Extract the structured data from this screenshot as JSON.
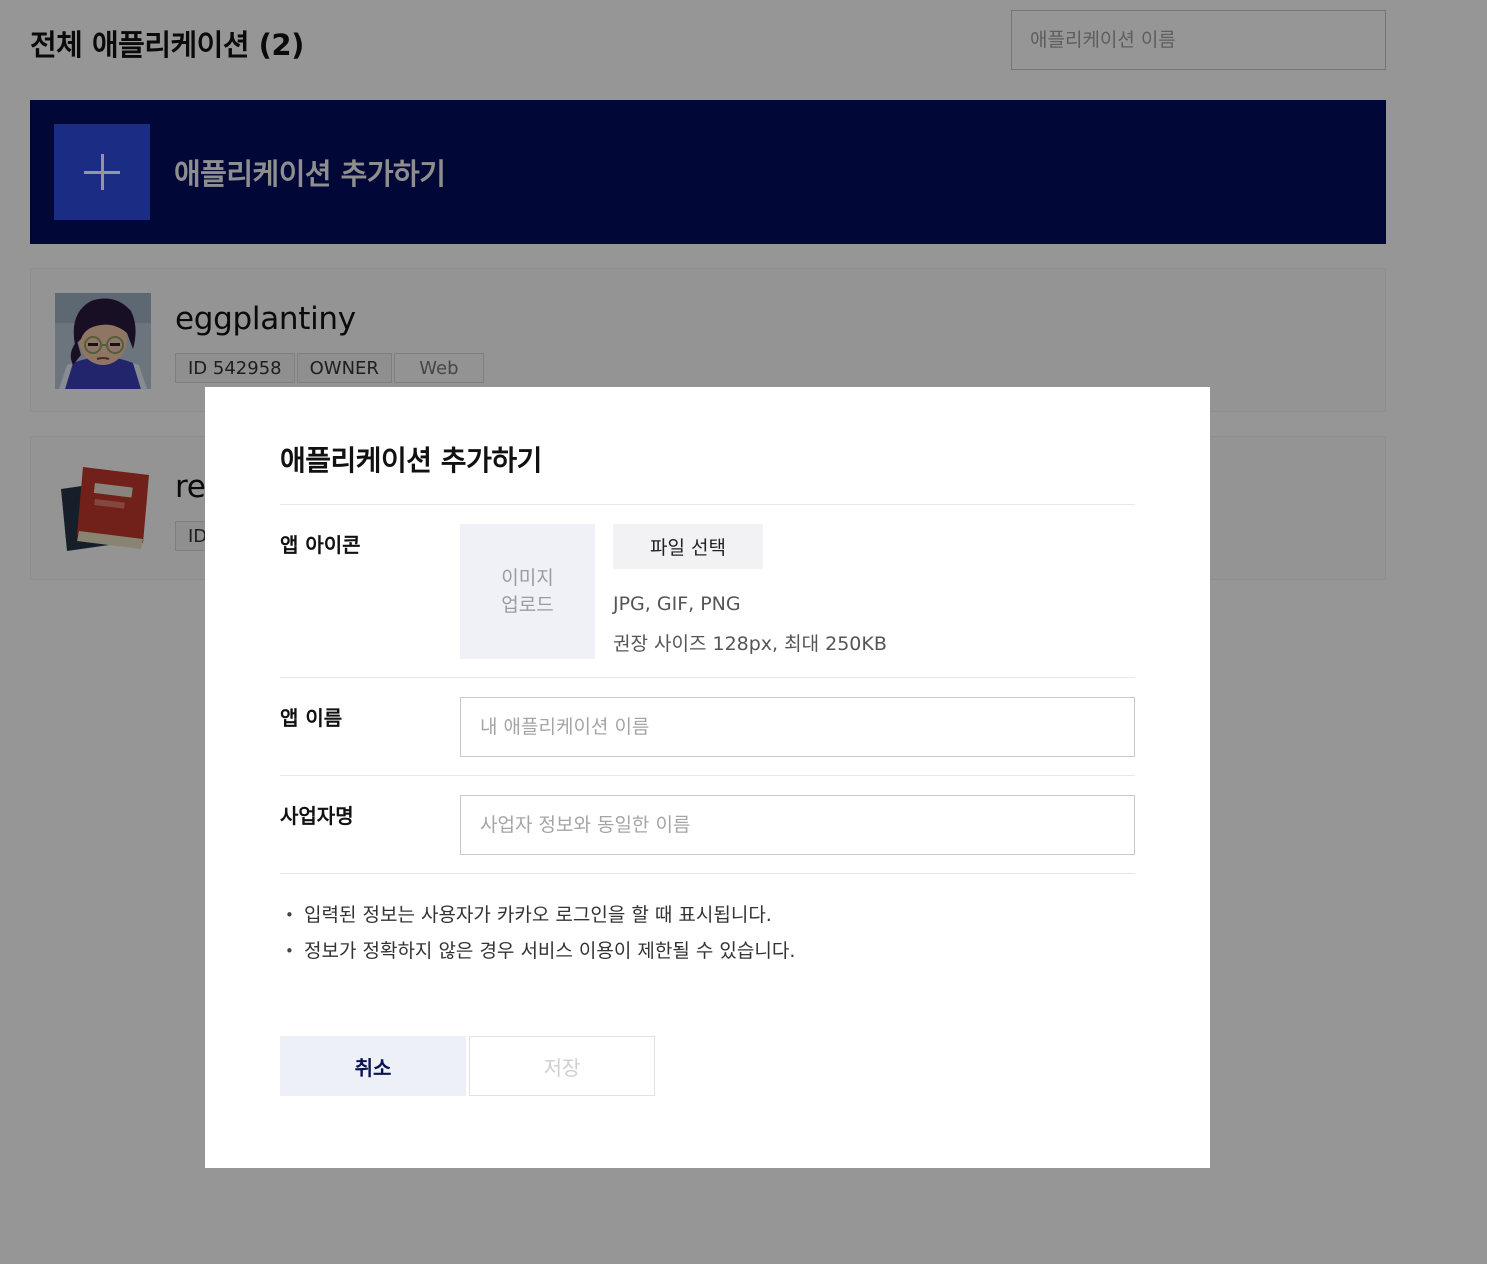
{
  "page": {
    "title": "전체 애플리케이션 (2)",
    "search_placeholder": "애플리케이션 이름"
  },
  "add_banner": {
    "label": "애플리케이션 추가하기",
    "icon": "plus-icon"
  },
  "apps": [
    {
      "name": "eggplantiny",
      "tags": [
        "ID 542958",
        "OWNER",
        "Web"
      ],
      "thumbnail": "character-avatar"
    },
    {
      "name": "re",
      "tags": [
        "ID"
      ],
      "thumbnail": "red-book-icon"
    }
  ],
  "modal": {
    "title": "애플리케이션 추가하기",
    "icon_label": "앱 아이콘",
    "upload_line1": "이미지",
    "upload_line2": "업로드",
    "file_button": "파일 선택",
    "file_hint_formats": "JPG, GIF, PNG",
    "file_hint_size": "권장 사이즈 128px, 최대 250KB",
    "name_label": "앱 이름",
    "name_placeholder": "내 애플리케이션 이름",
    "name_value": "",
    "biz_label": "사업자명",
    "biz_placeholder": "사업자 정보와 동일한 이름",
    "biz_value": "",
    "notes": [
      "입력된 정보는 사용자가 카카오 로그인을 할 때 표시됩니다.",
      "정보가 정확하지 않은 경우 서비스 이용이 제한될 수 있습니다."
    ],
    "cancel_label": "취소",
    "save_label": "저장"
  },
  "colors": {
    "banner_bg": "#020c5e",
    "plus_box_bg": "#2d4be0",
    "overlay": "rgba(0,0,0,0.41)",
    "cancel_text": "#0a1450"
  }
}
